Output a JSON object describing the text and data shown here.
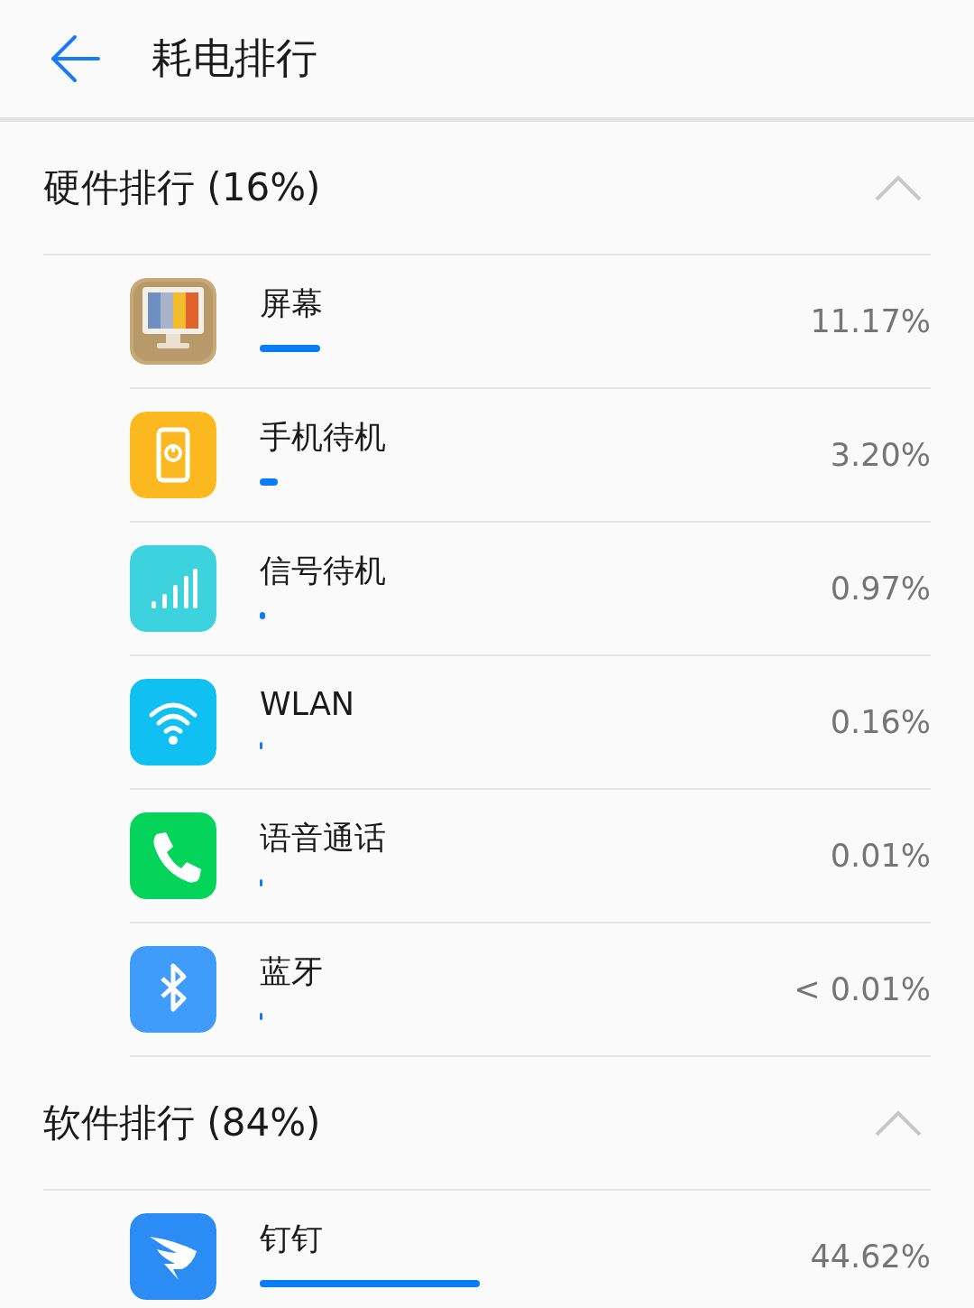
{
  "header": {
    "title": "耗电排行"
  },
  "sections": [
    {
      "title": "硬件排行 (16%)",
      "expanded": true,
      "items": [
        {
          "name": "屏幕",
          "kind": "monitor",
          "color": "#c9a878",
          "reading": "11.17%"
        },
        {
          "name": "手机待机",
          "kind": "standby",
          "color": "#fbb81f",
          "reading": "3.20%"
        },
        {
          "name": "信号待机",
          "kind": "signal",
          "color": "#3dd3de",
          "reading": "0.97%"
        },
        {
          "name": "WLAN",
          "kind": "wifi",
          "color": "#10c0f2",
          "reading": "0.16%"
        },
        {
          "name": "语音通话",
          "kind": "call",
          "color": "#05d45a",
          "reading": "0.01%"
        },
        {
          "name": "蓝牙",
          "kind": "bluetooth",
          "color": "#3f9cfb",
          "reading": "< 0.01%"
        }
      ]
    },
    {
      "title": "软件排行 (84%)",
      "expanded": true,
      "items": [
        {
          "name": "钉钉",
          "kind": "app",
          "color": "#2a8cf4",
          "reading": "44.62%"
        }
      ]
    }
  ]
}
